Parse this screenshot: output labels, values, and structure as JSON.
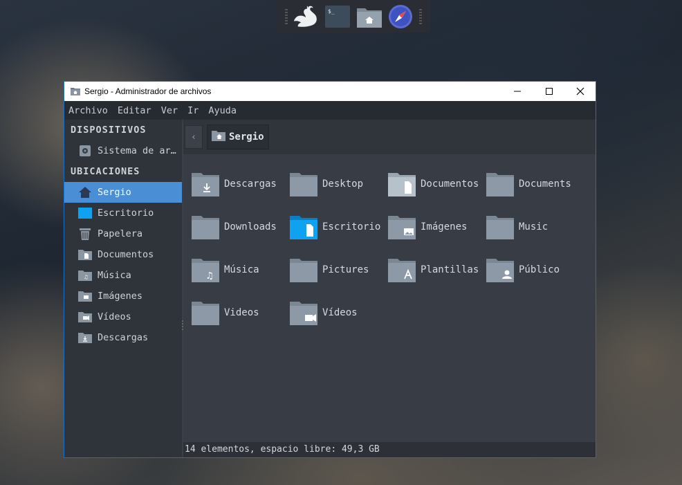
{
  "dock": {
    "items": [
      {
        "name": "swan-app-icon"
      },
      {
        "name": "terminal-icon",
        "glyph": "$_"
      },
      {
        "name": "home-folder-icon"
      },
      {
        "name": "compass-browser-icon"
      }
    ]
  },
  "window": {
    "title": "Sergio - Administrador de archivos",
    "controls": {
      "minimize": "minimize-icon",
      "maximize": "maximize-icon",
      "close": "close-icon"
    }
  },
  "menu": [
    "Archivo",
    "Editar",
    "Ver",
    "Ir",
    "Ayuda"
  ],
  "sidebar": {
    "devices_header": "DISPOSITIVOS",
    "devices": [
      {
        "label": "Sistema de ar…",
        "icon": "drive-icon"
      }
    ],
    "places_header": "UBICACIONES",
    "places": [
      {
        "label": "Sergio",
        "icon": "home-icon",
        "active": true
      },
      {
        "label": "Escritorio",
        "icon": "desktop-icon"
      },
      {
        "label": "Papelera",
        "icon": "trash-icon"
      },
      {
        "label": "Documentos",
        "icon": "documents-folder-icon"
      },
      {
        "label": "Música",
        "icon": "music-folder-icon"
      },
      {
        "label": "Imágenes",
        "icon": "pictures-folder-icon"
      },
      {
        "label": "Vídeos",
        "icon": "videos-folder-icon"
      },
      {
        "label": "Descargas",
        "icon": "downloads-folder-icon"
      }
    ]
  },
  "pathbar": {
    "back": "‹",
    "current": "Sergio"
  },
  "files": [
    {
      "label": "Descargas",
      "icon": "downloads-folder-icon",
      "badge": "download"
    },
    {
      "label": "Desktop",
      "icon": "folder-icon",
      "badge": ""
    },
    {
      "label": "Documentos",
      "icon": "documents-folder-icon",
      "badge": "doc"
    },
    {
      "label": "Documents",
      "icon": "folder-icon",
      "badge": ""
    },
    {
      "label": "Downloads",
      "icon": "folder-icon",
      "badge": ""
    },
    {
      "label": "Escritorio",
      "icon": "desktop-folder-icon",
      "badge": "desk"
    },
    {
      "label": "Imágenes",
      "icon": "pictures-folder-icon",
      "badge": "image"
    },
    {
      "label": "Music",
      "icon": "folder-icon",
      "badge": ""
    },
    {
      "label": "Música",
      "icon": "music-folder-icon",
      "badge": "music"
    },
    {
      "label": "Pictures",
      "icon": "folder-icon",
      "badge": ""
    },
    {
      "label": "Plantillas",
      "icon": "templates-folder-icon",
      "badge": "template"
    },
    {
      "label": "Público",
      "icon": "public-folder-icon",
      "badge": "user"
    },
    {
      "label": "Videos",
      "icon": "folder-icon",
      "badge": ""
    },
    {
      "label": "Vídeos",
      "icon": "videos-folder-icon",
      "badge": "video"
    }
  ],
  "status": "14 elementos, espacio libre: 49,3 GB",
  "colors": {
    "accent": "#4a8fd6",
    "folder": "#8d99a6",
    "folder_light": "#aab4be",
    "desktop_blue": "#0fa2f0",
    "window_border": "#1b6fc7"
  }
}
